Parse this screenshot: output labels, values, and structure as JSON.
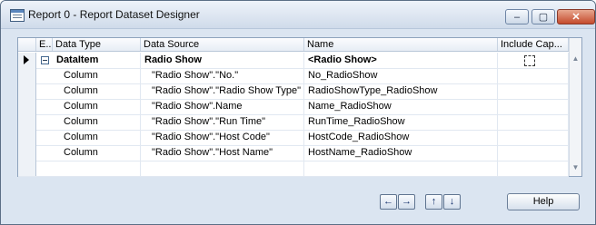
{
  "window": {
    "title": "Report 0 - Report Dataset Designer",
    "controls": {
      "minimize": "–",
      "maximize": "▢",
      "close": "✕"
    }
  },
  "grid": {
    "columns": [
      {
        "label": "E..."
      },
      {
        "label": "Data Type"
      },
      {
        "label": "Data Source"
      },
      {
        "label": "Name"
      },
      {
        "label": "Include Cap..."
      }
    ],
    "rows": [
      {
        "data_type": "DataItem",
        "data_source": "Radio Show",
        "name": "<Radio Show>",
        "expander": "−",
        "bold": true,
        "selected": true
      },
      {
        "data_type": "Column",
        "data_source": "\"Radio Show\".\"No.\"",
        "name": "No_RadioShow"
      },
      {
        "data_type": "Column",
        "data_source": "\"Radio Show\".\"Radio Show Type\"",
        "name": "RadioShowType_RadioShow"
      },
      {
        "data_type": "Column",
        "data_source": "\"Radio Show\".Name",
        "name": "Name_RadioShow"
      },
      {
        "data_type": "Column",
        "data_source": "\"Radio Show\".\"Run Time\"",
        "name": "RunTime_RadioShow"
      },
      {
        "data_type": "Column",
        "data_source": "\"Radio Show\".\"Host Code\"",
        "name": "HostCode_RadioShow"
      },
      {
        "data_type": "Column",
        "data_source": "\"Radio Show\".\"Host Name\"",
        "name": "HostName_RadioShow"
      },
      {
        "data_type": "",
        "data_source": "",
        "name": ""
      }
    ]
  },
  "footer": {
    "nav": {
      "left": "←",
      "right": "→",
      "up": "↑",
      "down": "↓"
    },
    "help_label": "Help"
  }
}
